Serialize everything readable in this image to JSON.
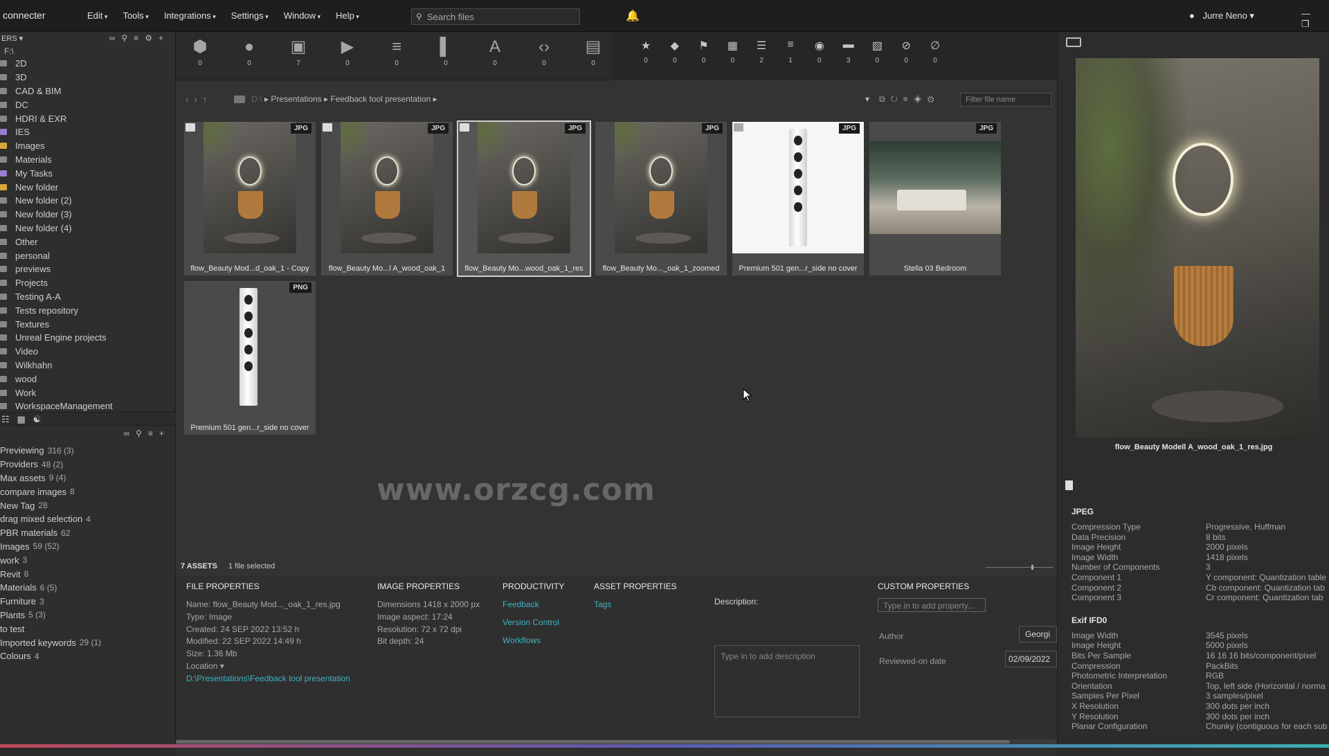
{
  "app": {
    "logo": "connecter"
  },
  "menu": [
    "Edit",
    "Tools",
    "Integrations",
    "Settings",
    "Window",
    "Help"
  ],
  "search": {
    "placeholder": "Search files"
  },
  "user": {
    "name": "Jurre Neno"
  },
  "sidebar": {
    "header": "ERS",
    "root": "F:\\",
    "folders": [
      "2D",
      "3D",
      "CAD & BIM",
      "DC",
      "HDRI & EXR",
      "IES",
      "Images",
      "Materials",
      "My Tasks",
      "New folder",
      "New folder (2)",
      "New folder (3)",
      "New folder (4)",
      "Other",
      "personal",
      "previews",
      "Projects",
      "Testing A-A",
      "Tests repository",
      "Textures",
      "Unreal Engine projects",
      "Video",
      "Wilkhahn",
      "wood",
      "Work",
      "WorkspaceManagement"
    ],
    "tags": [
      {
        "name": "Previewing",
        "count": "316 (3)"
      },
      {
        "name": "Providers",
        "count": "48 (2)"
      },
      {
        "name": "Max assets",
        "count": "9 (4)"
      },
      {
        "name": "compare images",
        "count": "8"
      },
      {
        "name": "New Tag",
        "count": "28"
      },
      {
        "name": "drag mixed selection",
        "count": "4"
      },
      {
        "name": "PBR materials",
        "count": "62"
      },
      {
        "name": "Images",
        "count": "59 (52)"
      },
      {
        "name": "work",
        "count": "3"
      },
      {
        "name": "Revit",
        "count": "8"
      },
      {
        "name": "Materials",
        "count": "6 (5)"
      },
      {
        "name": "Furniture",
        "count": "3"
      },
      {
        "name": "Plants",
        "count": "5 (3)"
      },
      {
        "name": "to test",
        "count": ""
      },
      {
        "name": "Imported keywords",
        "count": "29 (1)"
      },
      {
        "name": "Colours",
        "count": "4"
      }
    ]
  },
  "type_filters": [
    {
      "icon": "cube-icon",
      "count": "0"
    },
    {
      "icon": "sphere-icon",
      "count": "0"
    },
    {
      "icon": "image-icon",
      "count": "7"
    },
    {
      "icon": "video-icon",
      "count": "0"
    },
    {
      "icon": "audio-icon",
      "count": "0"
    },
    {
      "icon": "building-icon",
      "count": "0"
    },
    {
      "icon": "font-icon",
      "count": "0"
    },
    {
      "icon": "code-icon",
      "count": "0"
    },
    {
      "icon": "document-icon",
      "count": "0"
    }
  ],
  "meta_filters": [
    {
      "icon": "star-icon",
      "count": "0"
    },
    {
      "icon": "tag-icon",
      "count": "0"
    },
    {
      "icon": "flag-icon",
      "count": "0"
    },
    {
      "icon": "grid-icon",
      "count": "0"
    },
    {
      "icon": "list-icon",
      "count": "2"
    },
    {
      "icon": "align-icon",
      "count": "1"
    },
    {
      "icon": "camera-icon",
      "count": "0"
    },
    {
      "icon": "comment-icon",
      "count": "3"
    },
    {
      "icon": "board-icon",
      "count": "0"
    },
    {
      "icon": "hidden-icon",
      "count": "0"
    },
    {
      "icon": "blocked-icon",
      "count": "0"
    }
  ],
  "path": {
    "drive": "D:\\",
    "crumbs": [
      "Presentations",
      "Feedback tool presentation"
    ]
  },
  "filter": {
    "placeholder": "Filter file name"
  },
  "assets": [
    {
      "label": "flow_Beauty Mod...d_oak_1 - Copy",
      "badge": "JPG"
    },
    {
      "label": "flow_Beauty Mo...l A_wood_oak_1",
      "badge": "JPG"
    },
    {
      "label": "flow_Beauty Mo...wood_oak_1_res",
      "badge": "JPG"
    },
    {
      "label": "flow_Beauty Mo..._oak_1_zoomed",
      "badge": "JPG"
    },
    {
      "label": "Premium 501 gen...r_side no cover",
      "badge": "JPG"
    },
    {
      "label": "Stella 03 Bedroom",
      "badge": "JPG"
    },
    {
      "label": "Premium 501 gen...r_side no cover",
      "badge": "PNG"
    }
  ],
  "watermark": "www.orzcg.com",
  "status": {
    "assets": "7 ASSETS",
    "selected": "1 file selected"
  },
  "file_properties": {
    "title": "FILE PROPERTIES",
    "name": "Name: flow_Beauty Mod..._oak_1_res.jpg",
    "type": "Type: Image",
    "created": "Created: 24 SEP 2022 13:52 h",
    "modified": "Modified: 22 SEP 2022 14:49 h",
    "size": "Size: 1.36 Mb",
    "location_label": "Location",
    "location": "D:\\Presentations\\Feedback tool presentation"
  },
  "image_properties": {
    "title": "IMAGE PROPERTIES",
    "dimensions": "Dimensions 1418 x 2000 px",
    "aspect": "Image aspect: 17:24",
    "resolution": "Resolution: 72 x 72 dpi",
    "bitdepth": "Bit depth: 24"
  },
  "productivity": {
    "title": "PRODUCTIVITY",
    "links": [
      "Feedback",
      "Version Control",
      "Workflows"
    ]
  },
  "asset_properties": {
    "title": "ASSET PROPERTIES",
    "links": [
      "Tags"
    ]
  },
  "description": {
    "label": "Description:",
    "placeholder": "Type in to add description"
  },
  "custom_properties": {
    "title": "CUSTOM PROPERTIES",
    "placeholder": "Type in to add property...",
    "author_label": "Author",
    "author_value": "Georgi",
    "reviewed_label": "Reviewed-on date",
    "reviewed_value": "02/09/2022"
  },
  "preview": {
    "caption": "flow_Beauty Modell A_wood_oak_1_res.jpg"
  },
  "exif": {
    "jpeg_title": "JPEG",
    "jpeg": [
      {
        "k": "Compression Type",
        "v": "Progressive, Huffman"
      },
      {
        "k": "Data Precision",
        "v": "8 bits"
      },
      {
        "k": "Image Height",
        "v": "2000 pixels"
      },
      {
        "k": "Image Width",
        "v": "1418 pixels"
      },
      {
        "k": "Number of Components",
        "v": "3"
      },
      {
        "k": "Component 1",
        "v": "Y component: Quantization table"
      },
      {
        "k": "Component 2",
        "v": "Cb component: Quantization tab"
      },
      {
        "k": "Component 3",
        "v": "Cr component: Quantization tab"
      }
    ],
    "ifd_title": "Exif IFD0",
    "ifd": [
      {
        "k": "Image Width",
        "v": "3545 pixels"
      },
      {
        "k": "Image Height",
        "v": "5000 pixels"
      },
      {
        "k": "Bits Per Sample",
        "v": "16 16 16 bits/component/pixel"
      },
      {
        "k": "Compression",
        "v": "PackBits"
      },
      {
        "k": "Photometric Interpretation",
        "v": "RGB"
      },
      {
        "k": "Orientation",
        "v": "Top, left side (Horizontal / norma"
      },
      {
        "k": "Samples Per Pixel",
        "v": "3 samples/pixel"
      },
      {
        "k": "X Resolution",
        "v": "300 dots per inch"
      },
      {
        "k": "Y Resolution",
        "v": "300 dots per inch"
      },
      {
        "k": "Planar Configuration",
        "v": "Chunky (contiguous for each sub"
      }
    ]
  }
}
